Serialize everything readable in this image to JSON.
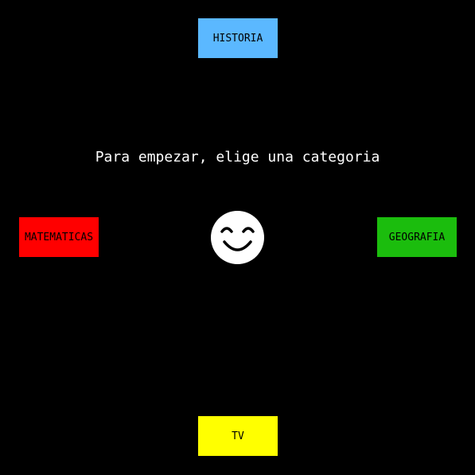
{
  "prompt": "Para empezar, elige una categoria",
  "categories": {
    "historia": {
      "label": "HISTORIA",
      "color": "#5bb8ff"
    },
    "matematicas": {
      "label": "MATEMATICAS",
      "color": "#ff0000"
    },
    "geografia": {
      "label": "GEOGRAFIA",
      "color": "#1bbd0d"
    },
    "tv": {
      "label": "TV",
      "color": "#ffff00"
    }
  },
  "center_icon": "smiling-face-icon",
  "background_color": "#000000"
}
